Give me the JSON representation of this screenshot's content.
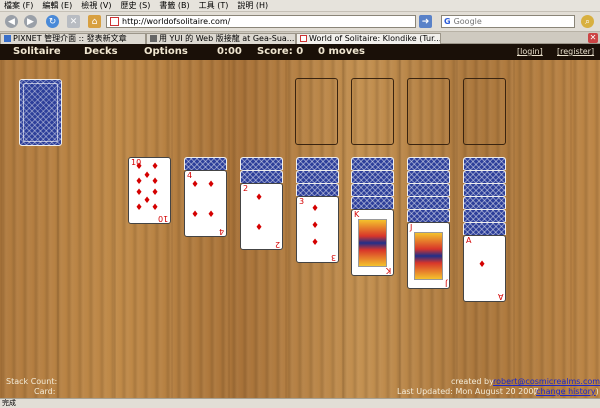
{
  "menu": [
    "檔案 (F)",
    "編輯 (E)",
    "檢視 (V)",
    "歷史 (S)",
    "書籤 (B)",
    "工具 (T)",
    "說明 (H)"
  ],
  "nav": {
    "url": "http://worldofsolitaire.com/",
    "search_placeholder": "Google",
    "search_logo": "G"
  },
  "tabs": [
    {
      "label": "PIXNET 管理介面 :: 發表新文章",
      "active": false
    },
    {
      "label": "用 YUI 的 Web 版接龍 at Gea-Sua...",
      "active": false
    },
    {
      "label": "World of Solitaire: Klondike (Tur...",
      "active": true
    }
  ],
  "game_bar": {
    "solitaire": "Solitaire",
    "decks": "Decks",
    "options": "Options",
    "time": "0:00",
    "score": "Score: 0",
    "moves": "0 moves",
    "login": "[login]",
    "register": "[register]"
  },
  "tableau": [
    {
      "hidden": 0,
      "rank": "10",
      "suit": "♦"
    },
    {
      "hidden": 1,
      "rank": "4",
      "suit": "♦"
    },
    {
      "hidden": 2,
      "rank": "2",
      "suit": "♦"
    },
    {
      "hidden": 3,
      "rank": "3",
      "suit": "♦"
    },
    {
      "hidden": 4,
      "rank": "K",
      "suit": "♦"
    },
    {
      "hidden": 5,
      "rank": "J",
      "suit": "♦"
    },
    {
      "hidden": 6,
      "rank": "A",
      "suit": "♦"
    }
  ],
  "bottom_left": {
    "stack_count_label": "Stack Count:",
    "card_label": "Card:"
  },
  "bottom_right": {
    "created_by_label": "created by",
    "author_email": "robert@cosmicrealms.com",
    "last_updated": "Last Updated: Mon August 20 2007",
    "change_history": "change history"
  },
  "status": "完成",
  "colors": {
    "felt": "#b07a3e",
    "card_back": "#2d3f9a",
    "red_suit": "#d40000",
    "game_bar": "#1a1008"
  }
}
